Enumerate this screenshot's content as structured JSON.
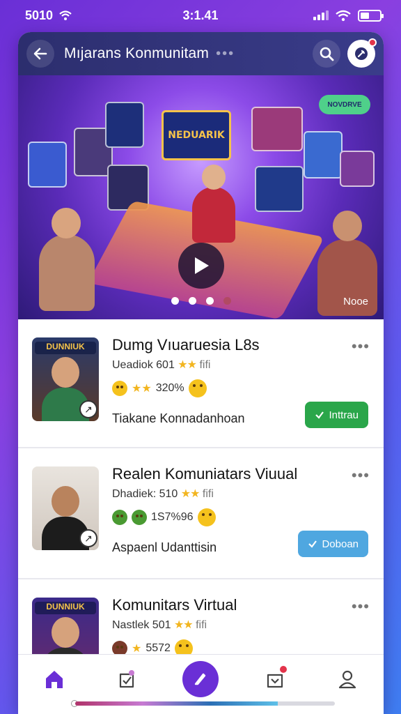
{
  "status_bar": {
    "left_text": "5010",
    "time": "3:1.41"
  },
  "header": {
    "title": "Mıjarans Konmunitam",
    "more_dots": "•••"
  },
  "hero": {
    "sign_text": "NEDUARIK",
    "bubble_text": "NOVDRVE",
    "more_label": "Nooe",
    "active_slide": 1,
    "slide_count": 4
  },
  "items": [
    {
      "title": "Dumg Vıuaruesia L8s",
      "meta_text": "Ueadiok 601",
      "meta_stars": "★★",
      "meta_extra": "fifi",
      "row2_stars": "★★",
      "row2_text": "320%",
      "subtitle": "Tiakane Konnadanhoan",
      "thumb_label": "DUNNIUK",
      "button_label": "Inttrau",
      "button_icon": "check-icon",
      "button_color": "green"
    },
    {
      "title": "Realen Komuniatars Viuual",
      "meta_text": "Dhadiek: 510",
      "meta_stars": "★★",
      "meta_extra": "fifi",
      "row2_text": "1S7%96",
      "subtitle": "Aspaenl Udanttisin",
      "thumb_label": "",
      "button_label": "Doboan",
      "button_icon": "check-icon",
      "button_color": "blue"
    },
    {
      "title": "Komunitars Virtual",
      "meta_text": "Nastlek 501",
      "meta_stars": "★★",
      "meta_extra": "fifi",
      "row2_stars": "★",
      "row2_text": "5572",
      "subtitle": "",
      "thumb_label": "DUNNIUK",
      "button_label": "",
      "button_icon": "",
      "button_color": ""
    }
  ],
  "bottom_nav": [
    {
      "name": "home-icon"
    },
    {
      "name": "badge-icon"
    },
    {
      "name": "compose-icon"
    },
    {
      "name": "inbox-icon"
    },
    {
      "name": "profile-icon"
    }
  ],
  "progress": 0.78,
  "colors": {
    "accent": "#6a2fd6",
    "header_bg": "#2c2e6e",
    "green_button": "#2aa64a",
    "blue_button": "#4fa7e0",
    "badge_red": "#e3344b"
  }
}
